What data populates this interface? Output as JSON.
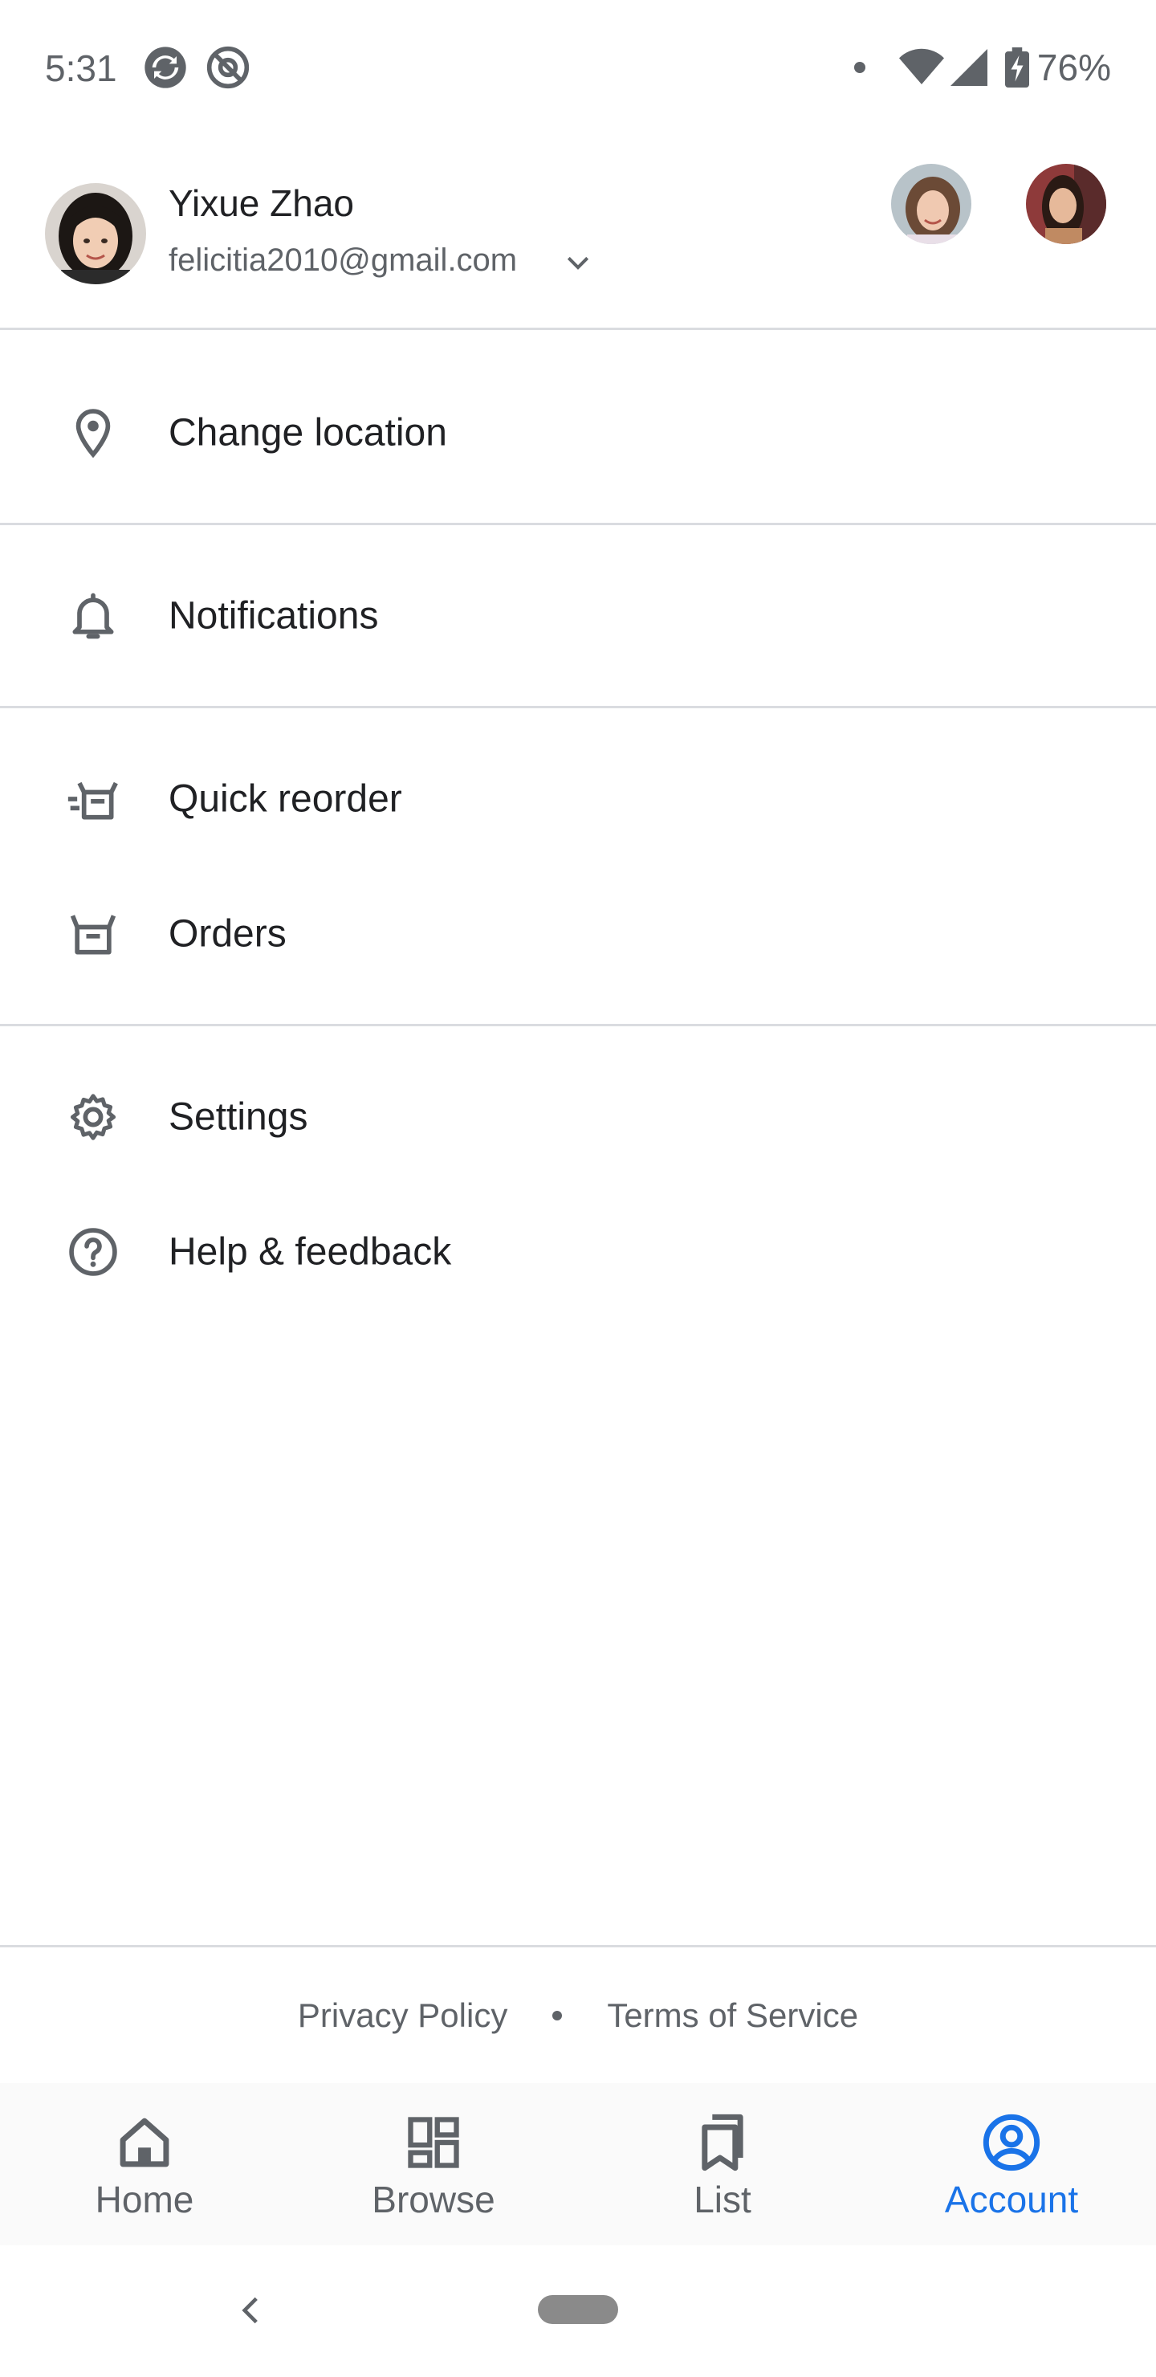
{
  "status_bar": {
    "time": "5:31",
    "battery": "76%"
  },
  "account": {
    "name": "Yixue Zhao",
    "email": "felicitia2010@gmail.com"
  },
  "menu": {
    "change_location": "Change location",
    "notifications": "Notifications",
    "quick_reorder": "Quick reorder",
    "orders": "Orders",
    "settings": "Settings",
    "help": "Help & feedback"
  },
  "footer": {
    "privacy": "Privacy Policy",
    "terms": "Terms of Service"
  },
  "bottom_nav": {
    "home": "Home",
    "browse": "Browse",
    "list": "List",
    "account": "Account"
  },
  "colors": {
    "accent": "#1a73e8",
    "icon": "#5f6368",
    "divider": "#dadce0"
  }
}
